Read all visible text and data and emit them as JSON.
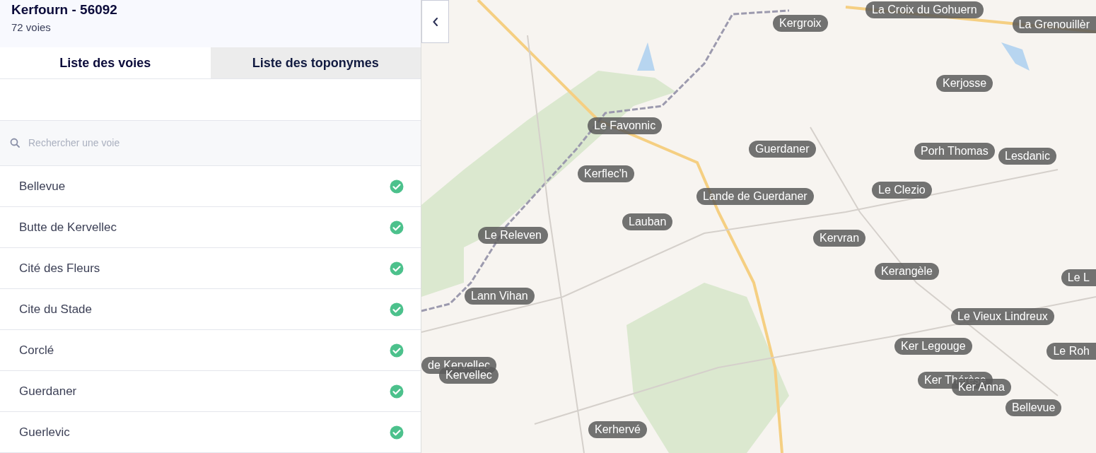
{
  "commune": {
    "title": "Kerfourn - 56092",
    "count": "72 voies"
  },
  "tabs": [
    {
      "label": "Liste des voies",
      "selected": true
    },
    {
      "label": "Liste des toponymes",
      "selected": false
    }
  ],
  "search": {
    "placeholder": "Rechercher une voie"
  },
  "voies": [
    {
      "name": "Bellevue",
      "certified": true
    },
    {
      "name": "Butte de Kervellec",
      "certified": true
    },
    {
      "name": "Cité des Fleurs",
      "certified": true
    },
    {
      "name": "Cite du Stade",
      "certified": true
    },
    {
      "name": "Corclé",
      "certified": true
    },
    {
      "name": "Guerdaner",
      "certified": true
    },
    {
      "name": "Guerlevic",
      "certified": true
    }
  ],
  "map": {
    "labels": [
      "Kergroix",
      "La Croix du Gohuern",
      "La Grenouillèr",
      "Kerjosse",
      "Le Favonnic",
      "Guerdaner",
      "Porh Thomas",
      "Lesdanic",
      "Kerflec'h",
      "Le Clezio",
      "Lande de Guerdaner",
      "Lauban",
      "Le Releven",
      "Kervran",
      "Kerangèle",
      "Le L",
      "Lann Vihan",
      "Le Vieux Lindreux",
      "Le Roh",
      "Ker Legouge",
      "de Kervellec",
      "Kervellec",
      "Ker Thérèse",
      "Ker Anna",
      "Bellevue",
      "Kerhervé"
    ]
  }
}
